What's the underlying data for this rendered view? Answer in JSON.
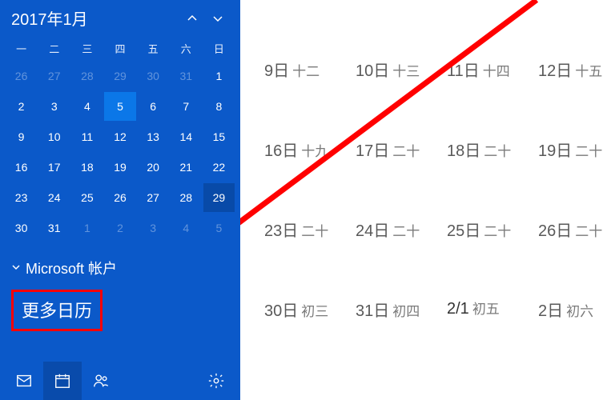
{
  "sidebar": {
    "month_title": "2017年1月",
    "weekdays": [
      "一",
      "二",
      "三",
      "四",
      "五",
      "六",
      "日"
    ],
    "weeks": [
      [
        {
          "n": "26",
          "dim": true
        },
        {
          "n": "27",
          "dim": true
        },
        {
          "n": "28",
          "dim": true
        },
        {
          "n": "29",
          "dim": true
        },
        {
          "n": "30",
          "dim": true
        },
        {
          "n": "31",
          "dim": true
        },
        {
          "n": "1"
        }
      ],
      [
        {
          "n": "2"
        },
        {
          "n": "3"
        },
        {
          "n": "4"
        },
        {
          "n": "5",
          "selected": true
        },
        {
          "n": "6"
        },
        {
          "n": "7"
        },
        {
          "n": "8"
        }
      ],
      [
        {
          "n": "9"
        },
        {
          "n": "10"
        },
        {
          "n": "11"
        },
        {
          "n": "12"
        },
        {
          "n": "13"
        },
        {
          "n": "14"
        },
        {
          "n": "15"
        }
      ],
      [
        {
          "n": "16"
        },
        {
          "n": "17"
        },
        {
          "n": "18"
        },
        {
          "n": "19"
        },
        {
          "n": "20"
        },
        {
          "n": "21"
        },
        {
          "n": "22"
        }
      ],
      [
        {
          "n": "23"
        },
        {
          "n": "24"
        },
        {
          "n": "25"
        },
        {
          "n": "26"
        },
        {
          "n": "27"
        },
        {
          "n": "28"
        },
        {
          "n": "29",
          "today": true
        }
      ],
      [
        {
          "n": "30"
        },
        {
          "n": "31"
        },
        {
          "n": "1",
          "dim": true
        },
        {
          "n": "2",
          "dim": true
        },
        {
          "n": "3",
          "dim": true
        },
        {
          "n": "4",
          "dim": true
        },
        {
          "n": "5",
          "dim": true
        }
      ]
    ],
    "account_label": "Microsoft 帐户",
    "more_calendars": "更多日历"
  },
  "main_rows": [
    [
      {
        "d": "9日",
        "s": "十二"
      },
      {
        "d": "10日",
        "s": "十三"
      },
      {
        "d": "11日",
        "s": "十四"
      },
      {
        "d": "12日",
        "s": "十五"
      }
    ],
    [
      {
        "d": "16日",
        "s": "十九"
      },
      {
        "d": "17日",
        "s": "二十"
      },
      {
        "d": "18日",
        "s": "二十"
      },
      {
        "d": "19日",
        "s": "二十"
      }
    ],
    [
      {
        "d": "23日",
        "s": "二十"
      },
      {
        "d": "24日",
        "s": "二十"
      },
      {
        "d": "25日",
        "s": "二十"
      },
      {
        "d": "26日",
        "s": "二十"
      }
    ],
    [
      {
        "d": "30日",
        "s": "初三"
      },
      {
        "d": "31日",
        "s": "初四"
      },
      {
        "d": "2/1",
        "s": "初五",
        "other": true
      },
      {
        "d": "2日",
        "s": "初六"
      }
    ]
  ]
}
